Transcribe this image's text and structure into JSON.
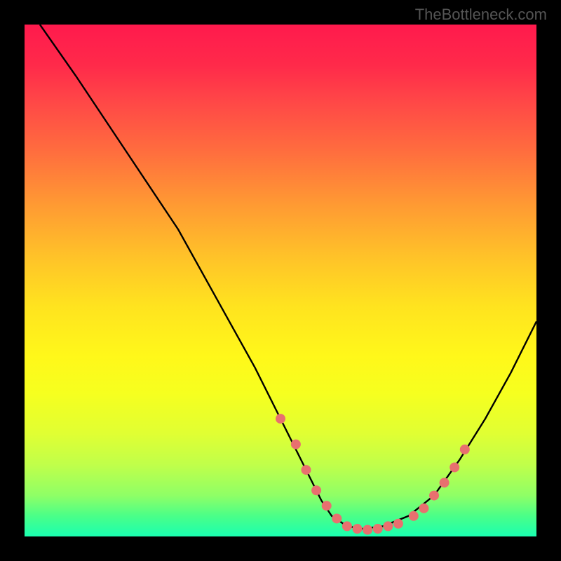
{
  "watermark": "TheBottleneck.com",
  "chart_data": {
    "type": "line",
    "title": "",
    "xlabel": "",
    "ylabel": "",
    "xlim": [
      0,
      100
    ],
    "ylim": [
      0,
      100
    ],
    "series": [
      {
        "name": "curve",
        "x": [
          3,
          10,
          20,
          30,
          40,
          45,
          50,
          55,
          58,
          60,
          63,
          66,
          70,
          75,
          80,
          85,
          90,
          95,
          100
        ],
        "y": [
          100,
          90,
          75,
          60,
          42,
          33,
          23,
          13,
          7,
          4,
          2,
          1.5,
          2,
          4,
          8,
          15,
          23,
          32,
          42
        ]
      }
    ],
    "markers": {
      "name": "highlighted-points",
      "color": "#e8706f",
      "x": [
        50,
        53,
        55,
        57,
        59,
        61,
        63,
        65,
        67,
        69,
        71,
        73,
        76,
        78,
        80,
        82,
        84,
        86
      ],
      "y": [
        23,
        18,
        13,
        9,
        6,
        3.5,
        2,
        1.5,
        1.3,
        1.5,
        2,
        2.5,
        4,
        5.5,
        8,
        10.5,
        13.5,
        17
      ]
    },
    "gradient_background": {
      "top_color": "#ff1a4d",
      "bottom_color": "#1affb0"
    }
  }
}
